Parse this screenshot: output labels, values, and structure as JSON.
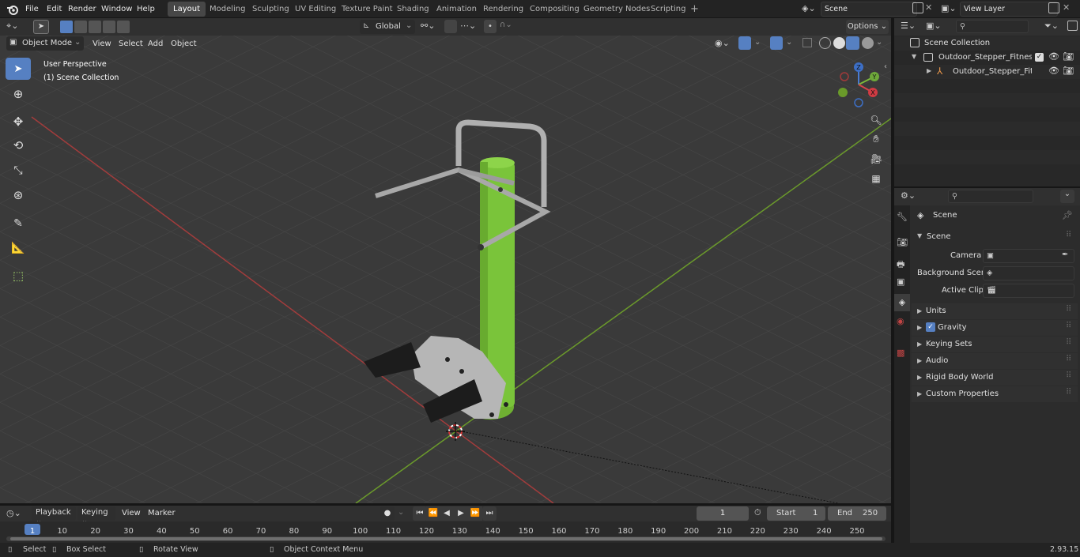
{
  "topbar": {
    "menus": [
      "File",
      "Edit",
      "Render",
      "Window",
      "Help"
    ],
    "workspaces": [
      "Layout",
      "Modeling",
      "Sculpting",
      "UV Editing",
      "Texture Paint",
      "Shading",
      "Animation",
      "Rendering",
      "Compositing",
      "Geometry Nodes",
      "Scripting"
    ],
    "active_workspace": "Layout",
    "scene_name": "Scene",
    "view_layer": "View Layer"
  },
  "viewport_header": {
    "mode": "Object Mode",
    "menus": [
      "View",
      "Select",
      "Add",
      "Object"
    ],
    "transform_orientation": "Global",
    "options_label": "Options"
  },
  "viewport": {
    "perspective_label": "User Perspective",
    "collection_label": "(1) Scene Collection",
    "gizmo_axes": {
      "x": "X",
      "y": "Y",
      "z": "Z"
    },
    "colors": {
      "background": "#393939",
      "grid": "#4a4a4a",
      "x_axis": "#b03a3a",
      "y_axis": "#6a9a2a",
      "model_green": "#7ac43a",
      "model_grey": "#b4b4b4"
    }
  },
  "outliner": {
    "root": "Scene Collection",
    "items": [
      {
        "label": "Outdoor_Stepper_Fitness_Equ",
        "level": 1
      },
      {
        "label": "Outdoor_Stepper_Fitness",
        "level": 2
      }
    ]
  },
  "properties": {
    "context_label": "Scene",
    "section": "Scene",
    "fields": [
      {
        "label": "Camera",
        "value": ""
      },
      {
        "label": "Background Scene",
        "value": ""
      },
      {
        "label": "Active Clip",
        "value": ""
      }
    ],
    "panels": [
      "Units",
      "Gravity",
      "Keying Sets",
      "Audio",
      "Rigid Body World",
      "Custom Properties"
    ],
    "gravity_checked": true
  },
  "timeline": {
    "menus": [
      "Playback",
      "Keying",
      "View",
      "Marker"
    ],
    "current_frame": "1",
    "start_label": "Start",
    "start_value": "1",
    "end_label": "End",
    "end_value": "250",
    "ticks": [
      "1",
      "10",
      "20",
      "30",
      "40",
      "50",
      "60",
      "70",
      "80",
      "90",
      "100",
      "110",
      "120",
      "130",
      "140",
      "150",
      "160",
      "170",
      "180",
      "190",
      "200",
      "210",
      "220",
      "230",
      "240",
      "250"
    ]
  },
  "statusbar": {
    "select": "Select",
    "box_select": "Box Select",
    "rotate_view": "Rotate View",
    "context_menu": "Object Context Menu",
    "version": "2.93.15"
  }
}
